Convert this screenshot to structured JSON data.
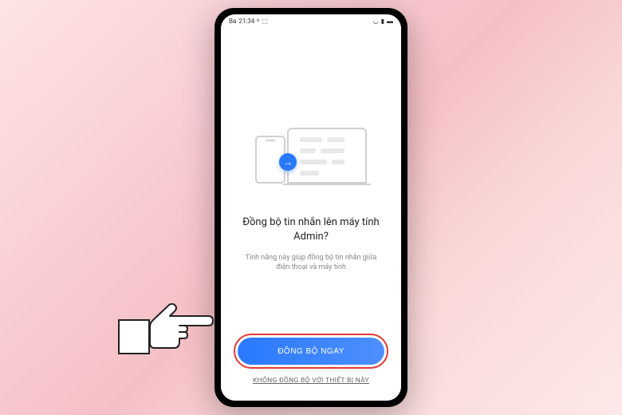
{
  "status_bar": {
    "carrier": "Ba",
    "time": "21:34",
    "icons": [
      "bt",
      "fb",
      "more"
    ]
  },
  "sync_screen": {
    "title": "Đồng bộ tin nhắn lên máy tính Admin?",
    "subtitle": "Tính năng này giúp đồng bộ tin nhắn giữa điện thoại và máy tính"
  },
  "buttons": {
    "primary": "ĐỒNG BỘ NGAY",
    "secondary": "KHÔNG ĐỒNG BỘ VỚI THIẾT BỊ NÀY"
  },
  "colors": {
    "primary_blue": "#2979ff",
    "highlight_red": "#e53935"
  }
}
